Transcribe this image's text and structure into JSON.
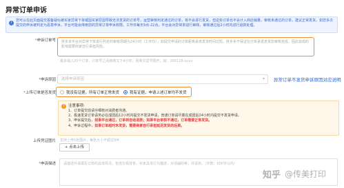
{
  "page": {
    "title": "异常订单申诉"
  },
  "banner": {
    "icon": "info-icon",
    "text": "您可以在此页面提交报备疑似被买家异常下单或因买家原因导致无法发货的订单号，运营审核判定通过的订单，将不会进行发货，但这些订单也不会计入商店销量，审核未通过的订单，建议正常发货，如您多次提交的申诉被判定为恶意申诉，平台可能会停用您的异常订单申诉权限。工作日每天9点-22点，平台会对异常单进行审核，审核通过后2小时内进行退款处理。"
  },
  "order_field": {
    "label_req": "*",
    "label": "申诉订单号",
    "placeholder": "拼多多平台对异常下单进行判定的审核周期为24小时（工作日），如提交申请的订单距离承诺发货时间过短，拼多多不保证在订单承诺发货前审核完成，因此造成的影响需要商家自行承担风险。",
    "hint": "最多输入20个订单，订单号之间用英文下4小时，而英文逗号隔开，如：200128-xxxx"
  },
  "reason_field": {
    "label_req": "*",
    "label": "申诉原因",
    "placeholder": "选择申诉原因",
    "link": "异常订单不发货申诉原因对应说明"
  },
  "proof_field": {
    "label_req": "*",
    "label": "上传订单是否发货",
    "options": [
      {
        "label": "我没有证据，所有订单正常发货",
        "selected": false
      },
      {
        "label": "我有证据，申请上述订单均不发货",
        "selected": true
      }
    ]
  },
  "notice": {
    "icon": "warning-icon",
    "title": "注意事项:",
    "items": [
      {
        "text": "1、订单提交前请仔细核对消费者沟通。",
        "red": ""
      },
      {
        "text": "2、极速发货订单请务必在成团后12小时内提交不发货申请，普通订单请尽量在成团后24小时内提交不发货申请。",
        "red": ""
      },
      {
        "text": "3、申诉提交后，",
        "red": "如果平台通过，订单将自动退款；如果平台审核不通过，订单需要正常发货。"
      },
      {
        "text": "4、申诉过程中，",
        "red": "如果订单超时未发货，需要商家自行承担延迟发货的后果。"
      }
    ]
  },
  "upload_field": {
    "label": "上传凭证图片",
    "hint": "支持上传5张图片，每张大小不超过8M",
    "button": "+ 点击上传"
  },
  "desc_field": {
    "label_req": "*",
    "label": "申诉描述",
    "placeholder": "请描述并请填写订单的具体情况，包括交易背景，买家具体行为描述，对话辅助等，并请务。（字数：600字以内）"
  },
  "watermark": {
    "logo": "知乎",
    "account": "@传美打印"
  },
  "colors": {
    "highlight": "#f08a2e",
    "link": "#2b66d9",
    "alert": "#e4393c"
  }
}
